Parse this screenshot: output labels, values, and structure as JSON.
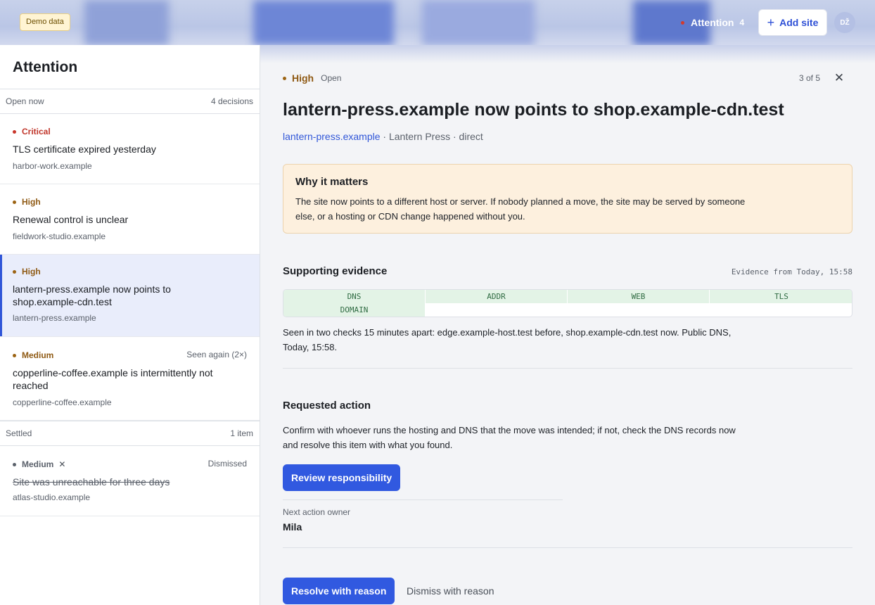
{
  "header": {
    "demo_badge": "Demo data",
    "attention_label": "Attention",
    "attention_count": "4",
    "add_site_label": "Add site",
    "avatar_initials": "DŽ"
  },
  "sidebar": {
    "title": "Attention",
    "open_group": {
      "label": "Open now",
      "count": "4 decisions"
    },
    "open_items": [
      {
        "severity": "Critical",
        "title": "TLS certificate expired yesterday",
        "site": "harbor-work.example",
        "meta": ""
      },
      {
        "severity": "High",
        "title": "Renewal control is unclear",
        "site": "fieldwork-studio.example",
        "meta": ""
      },
      {
        "severity": "High",
        "title": "lantern-press.example now points to shop.example-cdn.test",
        "site": "lantern-press.example",
        "meta": ""
      },
      {
        "severity": "Medium",
        "title": "copperline-coffee.example is intermittently not reached",
        "site": "copperline-coffee.example",
        "meta": "Seen again (2×)"
      }
    ],
    "settled_group": {
      "label": "Settled",
      "count": "1 item"
    },
    "settled_items": [
      {
        "severity": "Medium",
        "title": "Site was unreachable for three days",
        "site": "atlas-studio.example",
        "meta": "Dismissed"
      }
    ]
  },
  "detail": {
    "severity": "High",
    "status": "Open",
    "pager": "3 of 5",
    "title": "lantern-press.example now points to shop.example-cdn.test",
    "site_link": "lantern-press.example",
    "site_meta": " · Lantern Press · direct",
    "why": {
      "heading": "Why it matters",
      "body": "The site now points to a different host or server. If nobody planned a move, the site may be served by someone else, or a hosting or CDN change happened without you."
    },
    "evidence": {
      "heading": "Supporting evidence",
      "timestamp": "Evidence from Today, 15:58",
      "chips": [
        "DNS",
        "ADDR",
        "WEB",
        "TLS",
        "DOMAIN"
      ],
      "body": "Seen in two checks 15 minutes apart: edge.example-host.test before, shop.example-cdn.test now. Public DNS, Today, 15:58."
    },
    "action": {
      "heading": "Requested action",
      "body": "Confirm with whoever runs the hosting and DNS that the move was intended; if not, check the DNS records now and resolve this item with what you found.",
      "button": "Review responsibility",
      "owner_label": "Next action owner",
      "owner_value": "Mila"
    },
    "footer": {
      "resolve_label": "Resolve with reason",
      "dismiss_label": "Dismiss with reason"
    }
  },
  "colors": {
    "accent": "#3159e0",
    "critical": "#c9362b",
    "high": "#9c6414",
    "evidence_chip": "#e3f3e6",
    "why_panel": "#fdf0de"
  },
  "icons": [
    "plus-icon",
    "close-icon",
    "severity-dot-icon",
    "dismissed-x-icon"
  ]
}
